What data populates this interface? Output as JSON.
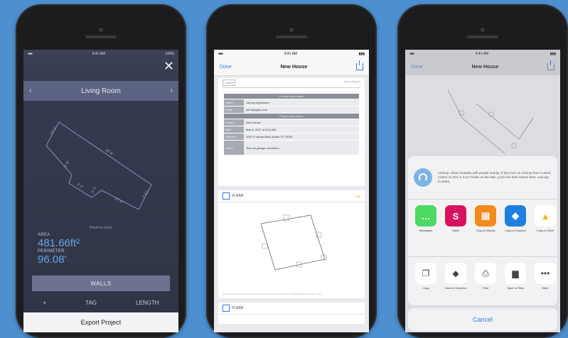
{
  "phone1": {
    "status": {
      "time": "9:41 AM",
      "battery": "100%"
    },
    "close_label": "✕",
    "header": {
      "prev": "‹",
      "title": "Living Room",
      "next": "›"
    },
    "dims": [
      "13' 3\"",
      "33' 6\"",
      "7' 11\"",
      "2' 5\"",
      "3' 2\"",
      "12' 0\"",
      "3' 1\""
    ],
    "hint": "Pinch to zoom",
    "area_label": "AREA",
    "area_value": "481.66ft²",
    "perimeter_label": "PERIMETER",
    "perimeter_value": "96.08'",
    "walls_label": "WALLS",
    "tools": {
      "add": "+",
      "tag": "TAG",
      "length": "LENGTH"
    },
    "export_label": "Export Project"
  },
  "phone2": {
    "status": {
      "time": "9:41 AM"
    },
    "nav": {
      "done": "Done",
      "title": "New House"
    },
    "report": {
      "page_info": "1 of 13",
      "right_link": "Insert Report",
      "section1": "Contact Information",
      "rows1": [
        {
          "key": "Name",
          "value": "Johnny Appleseed"
        },
        {
          "key": "Email",
          "value": "john@apple.com"
        }
      ],
      "section2": "Project Information",
      "rows2": [
        {
          "key": "Project",
          "value": "New House"
        },
        {
          "key": "Date",
          "value": "May 8, 2017 at 9:41 AM"
        },
        {
          "key": "Address",
          "value": "1000 S Lamar Blvd, Austin TX 78704"
        },
        {
          "key": "Notes",
          "value": "Two car garage, mudroom"
        }
      ]
    },
    "plan": {
      "brand": "FLNAR",
      "edit": "Edit",
      "footer": "All measurements are approximate and should be verified prior to use. Generated with Floor Plan Creator."
    },
    "plan2_brand": "FLNAR"
  },
  "phone3": {
    "status": {
      "time": "9:41 AM"
    },
    "nav": {
      "done": "Done",
      "title": "New House"
    },
    "airdrop_text": "AirDrop. Share instantly with people nearby. If they turn on AirDrop from Control Center on iOS or from Finder on the Mac, you'll see their names here. Just tap to share.",
    "apps": [
      {
        "label": "Messages",
        "color": "#4cd964",
        "glyph": "…"
      },
      {
        "label": "Slack",
        "color": "#d8135e",
        "glyph": "S"
      },
      {
        "label": "Copy to iBooks",
        "color": "#f28a1c",
        "glyph": "▤"
      },
      {
        "label": "Copy to Dropbox",
        "color": "#1f7fe0",
        "glyph": "◆"
      },
      {
        "label": "Copy to Drive",
        "color": "#ffffff",
        "glyph": "▲"
      }
    ],
    "actions": [
      {
        "label": "Copy",
        "glyph": "❐"
      },
      {
        "label": "Save to Dropbox",
        "glyph": "◆"
      },
      {
        "label": "Print",
        "glyph": "⎙"
      },
      {
        "label": "Save to Files",
        "glyph": "▆"
      },
      {
        "label": "More",
        "glyph": "•••"
      }
    ],
    "cancel_label": "Cancel"
  }
}
